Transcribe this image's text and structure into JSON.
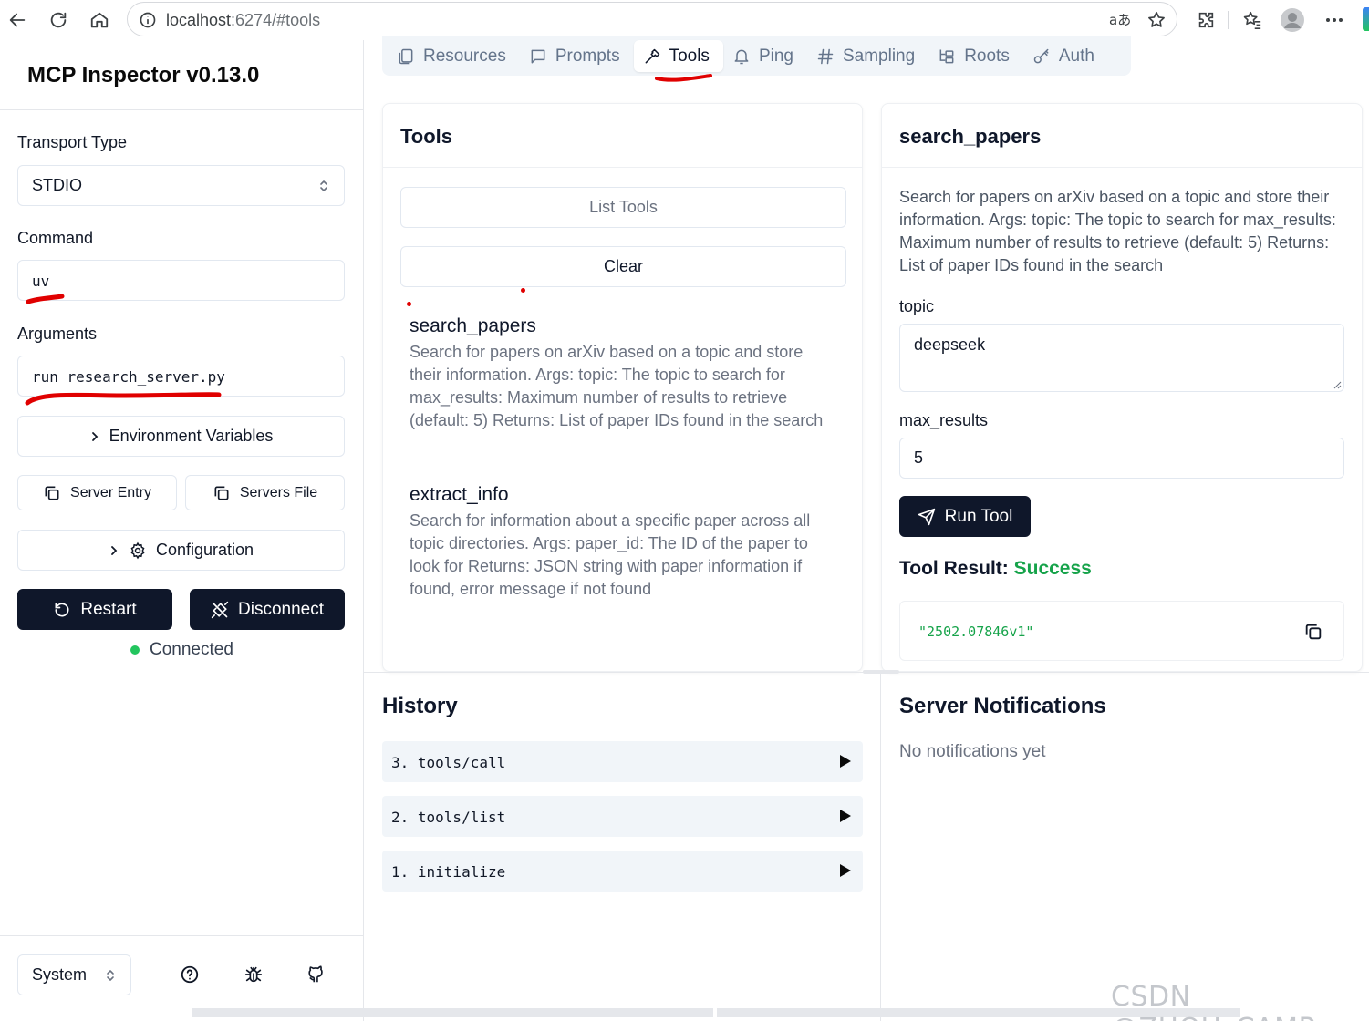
{
  "browser": {
    "url_host": "localhost",
    "url_rest": ":6274/#tools"
  },
  "sidebar": {
    "title": "MCP Inspector v0.13.0",
    "transport_label": "Transport Type",
    "transport_value": "STDIO",
    "command_label": "Command",
    "command_value": "uv",
    "arguments_label": "Arguments",
    "arguments_value": "run research_server.py",
    "env_vars_label": "Environment Variables",
    "server_entry_label": "Server Entry",
    "servers_file_label": "Servers File",
    "configuration_label": "Configuration",
    "restart_label": "Restart",
    "disconnect_label": "Disconnect",
    "status_text": "Connected",
    "theme_value": "System"
  },
  "tabs": [
    {
      "label": "Resources",
      "icon": "file-icon"
    },
    {
      "label": "Prompts",
      "icon": "message-icon"
    },
    {
      "label": "Tools",
      "icon": "hammer-icon",
      "active": true
    },
    {
      "label": "Ping",
      "icon": "bell-icon"
    },
    {
      "label": "Sampling",
      "icon": "hash-icon"
    },
    {
      "label": "Roots",
      "icon": "folder-tree-icon"
    },
    {
      "label": "Auth",
      "icon": "key-icon"
    }
  ],
  "tools_panel": {
    "title": "Tools",
    "list_button": "List Tools",
    "clear_button": "Clear",
    "items": [
      {
        "name": "search_papers",
        "description": "Search for papers on arXiv based on a topic and store their information. Args: topic: The topic to search for max_results: Maximum number of results to retrieve (default: 5) Returns: List of paper IDs found in the search"
      },
      {
        "name": "extract_info",
        "description": "Search for information about a specific paper across all topic directories. Args: paper_id: The ID of the paper to look for Returns: JSON string with paper information if found, error message if not found"
      }
    ]
  },
  "detail_panel": {
    "title": "search_papers",
    "description": "Search for papers on arXiv based on a topic and store their information. Args: topic: The topic to search for max_results: Maximum number of results to retrieve (default: 5) Returns: List of paper IDs found in the search",
    "topic_label": "topic",
    "topic_value": "deepseek",
    "max_results_label": "max_results",
    "max_results_value": "5",
    "run_button": "Run Tool",
    "result_label": "Tool Result:",
    "result_status": "Success",
    "result_value": "\"2502.07846v1\""
  },
  "history": {
    "title": "History",
    "items": [
      {
        "text": "3. tools/call"
      },
      {
        "text": "2. tools/list"
      },
      {
        "text": "1. initialize"
      }
    ]
  },
  "notifications": {
    "title": "Server Notifications",
    "empty_text": "No notifications yet"
  },
  "watermark": "CSDN @ZHOU_CAMP",
  "colors": {
    "primary": "#0f172a",
    "success": "#16a34a",
    "connected": "#22c55e",
    "annotation": "#e00000"
  }
}
